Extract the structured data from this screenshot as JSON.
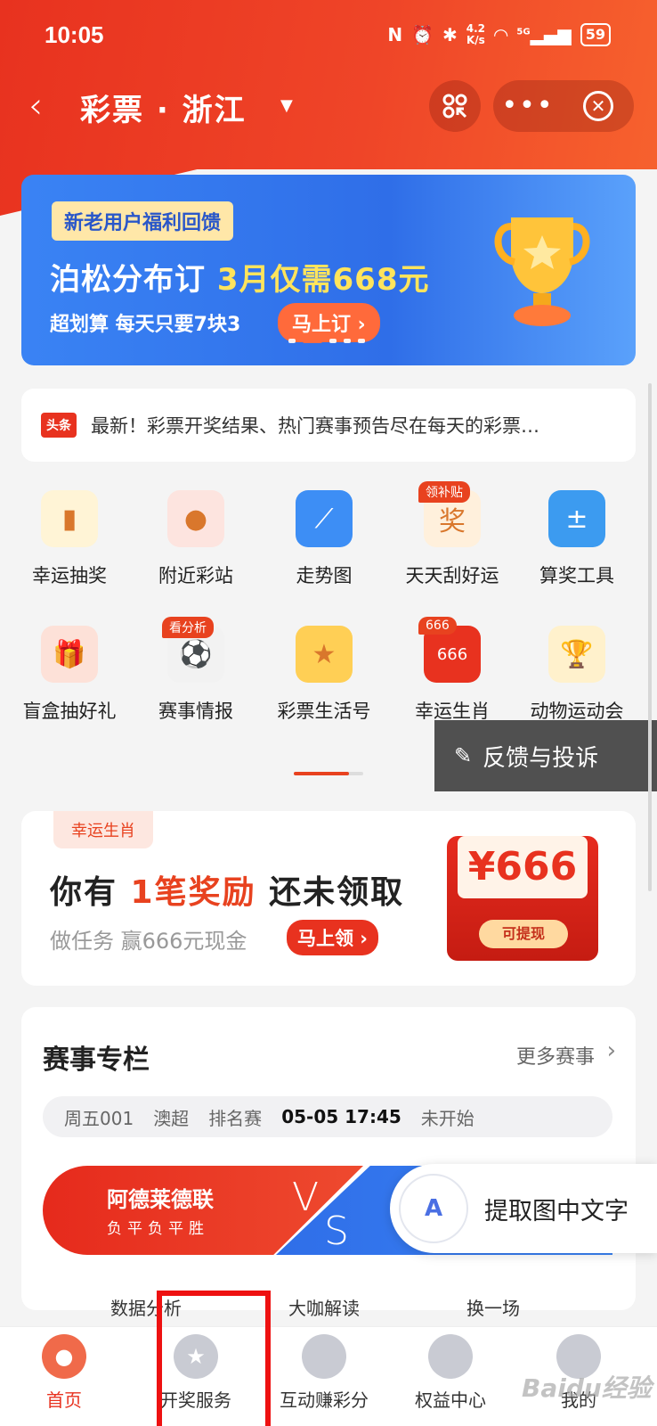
{
  "status_bar": {
    "time": "10:05",
    "speed_top": "4.2",
    "speed_unit": "K/s",
    "network": "5G",
    "battery": "59"
  },
  "navbar": {
    "back_glyph": "‹",
    "title": "彩票 · 浙江",
    "caret": "▼",
    "more_glyph": "•••",
    "close_glyph": "✕"
  },
  "banner": {
    "tag": "新老用户福利回馈",
    "headline_a": "泊松分布订",
    "headline_b": "3月仅需668元",
    "sub": "超划算 每天只要7块3",
    "cta": "马上订 ›"
  },
  "news": {
    "badge": "头条",
    "text": "最新！彩票开奖结果、热门赛事预告尽在每天的彩票…"
  },
  "grid": [
    {
      "label": "幸运抽奖",
      "icon": "gold-bar-icon",
      "corner": "",
      "bg": "#fff4d6",
      "glyph": "▮"
    },
    {
      "label": "附近彩站",
      "icon": "location-pin-icon",
      "corner": "",
      "bg": "#fde4df",
      "glyph": "●"
    },
    {
      "label": "走势图",
      "icon": "trend-chart-icon",
      "corner": "",
      "bg": "#3d8ef5",
      "glyph": "⟋"
    },
    {
      "label": "天天刮好运",
      "icon": "scratch-ticket-icon",
      "corner": "领补贴",
      "bg": "#fff0dc",
      "glyph": "奖"
    },
    {
      "label": "算奖工具",
      "icon": "calculator-icon",
      "corner": "",
      "bg": "#3c9bf0",
      "glyph": "±"
    },
    {
      "label": "盲盒抽好礼",
      "icon": "gift-box-icon",
      "corner": "",
      "bg": "#fde1d8",
      "glyph": "🎁"
    },
    {
      "label": "赛事情报",
      "icon": "soccer-ball-icon",
      "corner": "看分析",
      "bg": "#f2f2f2",
      "glyph": "⚽"
    },
    {
      "label": "彩票生活号",
      "icon": "star-badge-icon",
      "corner": "",
      "bg": "#ffcf55",
      "glyph": "★"
    },
    {
      "label": "幸运生肖",
      "icon": "red-envelope-icon",
      "corner": "666",
      "bg": "#e8321f",
      "glyph": "666"
    },
    {
      "label": "动物运动会",
      "icon": "trophy-icon",
      "corner": "",
      "bg": "#fff1cc",
      "glyph": "🏆"
    }
  ],
  "feedback": {
    "label": "反馈与投诉"
  },
  "reward": {
    "tag": "幸运生肖",
    "title_a": "你有 ",
    "title_red": "1笔奖励",
    "title_b": " 还未领取",
    "sub": "做任务 赢666元现金",
    "cta": "马上领 ›",
    "amount": "¥666",
    "pill": "可提现"
  },
  "events": {
    "heading": "赛事专栏",
    "more": "更多赛事",
    "match_no": "周五001",
    "league": "澳超",
    "round": "排名赛",
    "time": "05-05 17:45",
    "status": "未开始",
    "home": "阿德莱德联",
    "home_record": "负平负平胜",
    "vs_v": "V",
    "vs_s": "S"
  },
  "sub_row": [
    "数据分析",
    "大咖解读",
    "换一场"
  ],
  "extract": {
    "label": "提取图中文字",
    "icon_glyph": "A"
  },
  "tabbar": [
    {
      "label": "首页",
      "active": true,
      "color": "#f06a4a"
    },
    {
      "label": "开奖服务",
      "active": false,
      "color": "#c9cbd3"
    },
    {
      "label": "互动赚彩分",
      "active": false,
      "color": "#c9cbd3"
    },
    {
      "label": "权益中心",
      "active": false,
      "color": "#c9cbd3"
    },
    {
      "label": "我的",
      "active": false,
      "color": "#c9cbd3"
    }
  ],
  "watermark": "Baidu经验"
}
